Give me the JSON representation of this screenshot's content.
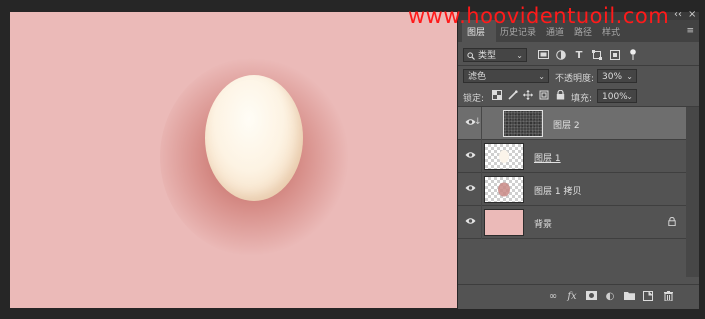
{
  "watermark": "www.hoovidentuoil.com",
  "window": {
    "collapse": "‹‹",
    "close": "×"
  },
  "tabs": [
    {
      "label": "图层",
      "active": true
    },
    {
      "label": "历史记录",
      "active": false
    },
    {
      "label": "通道",
      "active": false
    },
    {
      "label": "路径",
      "active": false
    },
    {
      "label": "样式",
      "active": false
    }
  ],
  "panel_menu": "≡",
  "filter": {
    "search_icon": "search-icon",
    "kind_label": "类型",
    "chevron": "⌄"
  },
  "blend": {
    "mode": "滤色",
    "opacity_label": "不透明度:",
    "opacity_value": "30%"
  },
  "lock": {
    "label": "锁定:",
    "fill_label": "填充:",
    "fill_value": "100%"
  },
  "layers": [
    {
      "name": "图层 2",
      "selected": true,
      "clip": true
    },
    {
      "name": "图层 1",
      "selected": false
    },
    {
      "name": "图层 1 拷贝",
      "selected": false
    },
    {
      "name": "背景",
      "selected": false,
      "locked": true
    }
  ],
  "footer": {
    "link": "∞",
    "fx": "fx",
    "mask": "■",
    "adjust": "◐",
    "folder": "▬",
    "new": "+",
    "delete": "🗑"
  },
  "colors": {
    "canvas_bg": "#ebbab8",
    "panel_bg": "#535353",
    "selected_layer": "#6e6e6e",
    "watermark": "#ff1a1a",
    "background_layer_thumb": "#ebbab8"
  }
}
